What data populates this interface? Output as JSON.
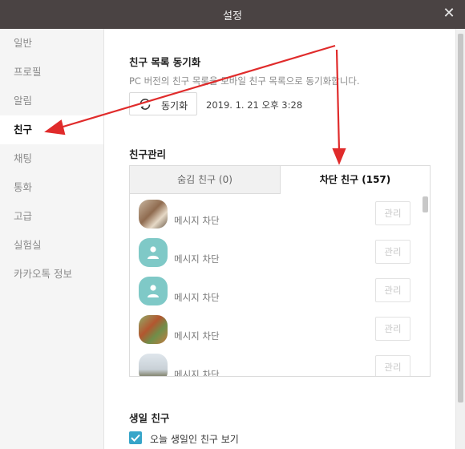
{
  "window": {
    "title": "설정",
    "close_glyph": "✕"
  },
  "sidebar": {
    "items": [
      {
        "label": "일반"
      },
      {
        "label": "프로필"
      },
      {
        "label": "알림"
      },
      {
        "label": "친구",
        "active": true
      },
      {
        "label": "채팅"
      },
      {
        "label": "통화"
      },
      {
        "label": "고급"
      },
      {
        "label": "실험실"
      },
      {
        "label": "카카오톡 정보"
      }
    ]
  },
  "sync": {
    "heading": "친구 목록 동기화",
    "description": "PC 버전의 친구 목록을 모바일 친구 목록으로 동기화합니다.",
    "button_label": "동기화",
    "button_icon": "refresh-icon",
    "last_synced": "2019. 1. 21 오후 3:28"
  },
  "friend_manage": {
    "heading": "친구관리",
    "tabs": [
      {
        "label": "숨김 친구 (0)",
        "active": false
      },
      {
        "label": "차단 친구 (157)",
        "active": true
      }
    ],
    "rows": [
      {
        "name": "메시지 차단",
        "button": "관리",
        "avatar": "photo-dog"
      },
      {
        "name": "메시지 차단",
        "button": "관리",
        "avatar": "default-person"
      },
      {
        "name": "메시지 차단",
        "button": "관리",
        "avatar": "default-person"
      },
      {
        "name": "메시지 차단",
        "button": "관리",
        "avatar": "photo-rooster"
      },
      {
        "name": "메시지 차단",
        "button": "관리",
        "avatar": "photo-beach"
      }
    ]
  },
  "birthday": {
    "heading": "생일 친구",
    "checkbox_label": "오늘 생일인 친구 보기",
    "checked": true
  },
  "colors": {
    "titlebar": "#4a4343",
    "accent_checkbox": "#37a5c9",
    "default_avatar": "#7fc9c7",
    "annotation_arrow": "#e02b2b"
  }
}
